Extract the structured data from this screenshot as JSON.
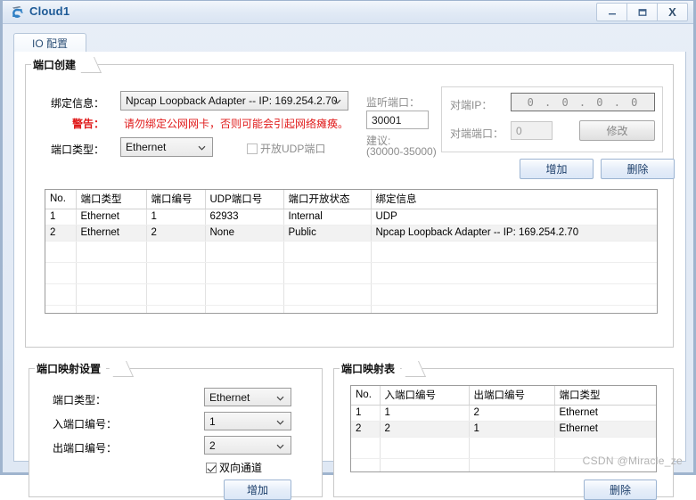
{
  "window": {
    "title": "Cloud1",
    "icon": "cloud-network-icon",
    "minimize_label": "–",
    "maximize_label": "❐",
    "close_label": "X"
  },
  "tabs": [
    {
      "label": "IO 配置",
      "name": "tab-io-config",
      "active": true
    }
  ],
  "port_create": {
    "group_title": "端口创建",
    "binding_label": "绑定信息：",
    "binding_value": "Npcap Loopback Adapter -- IP: 169.254.2.70",
    "warning_label": "警告：",
    "warning_text": "请勿绑定公网网卡，否则可能会引起网络瘫痪。",
    "port_type_label": "端口类型：",
    "port_type_value": "Ethernet",
    "udp_checkbox_label": "开放UDP端口",
    "udp_checkbox_checked": false,
    "listen_port_label": "监听端口：",
    "listen_port_value": "30001",
    "suggest_label": "建议:",
    "suggest_range": "(30000-35000)",
    "peer_ip_label": "对端IP：",
    "peer_ip_octets": [
      "0",
      "0",
      "0",
      "0"
    ],
    "peer_port_label": "对端端口：",
    "peer_port_value": "0",
    "modify_button": "修改",
    "add_button": "增加",
    "delete_button": "删除"
  },
  "port_table": {
    "columns": [
      "No.",
      "端口类型",
      "端口编号",
      "UDP端口号",
      "端口开放状态",
      "绑定信息"
    ],
    "rows": [
      [
        "1",
        "Ethernet",
        "1",
        "62933",
        "Internal",
        "UDP"
      ],
      [
        "2",
        "Ethernet",
        "2",
        "None",
        "Public",
        "Npcap Loopback Adapter -- IP: 169.254.2.70"
      ]
    ],
    "empty_rows": 5,
    "selected_row_index": 1
  },
  "map_settings": {
    "group_title": "端口映射设置",
    "port_type_label": "端口类型：",
    "port_type_value": "Ethernet",
    "in_port_label": "入端口编号：",
    "in_port_value": "1",
    "out_port_label": "出端口编号：",
    "out_port_value": "2",
    "bidirectional_label": "双向通道",
    "bidirectional_checked": true,
    "add_button": "增加"
  },
  "map_table": {
    "group_title": "端口映射表",
    "columns": [
      "No.",
      "入端口编号",
      "出端口编号",
      "端口类型"
    ],
    "rows": [
      [
        "1",
        "1",
        "2",
        "Ethernet"
      ],
      [
        "2",
        "2",
        "1",
        "Ethernet"
      ]
    ],
    "empty_rows": 3,
    "selected_row_index": 1,
    "delete_button": "删除"
  },
  "watermark": "CSDN @Miracle_ze",
  "colors": {
    "title_text": "#1e5a96",
    "warning": "#e01b1b",
    "button_text": "#1d3f6b",
    "disabled_text": "#8d8d8d",
    "selected_row": "#f2f2f2"
  }
}
